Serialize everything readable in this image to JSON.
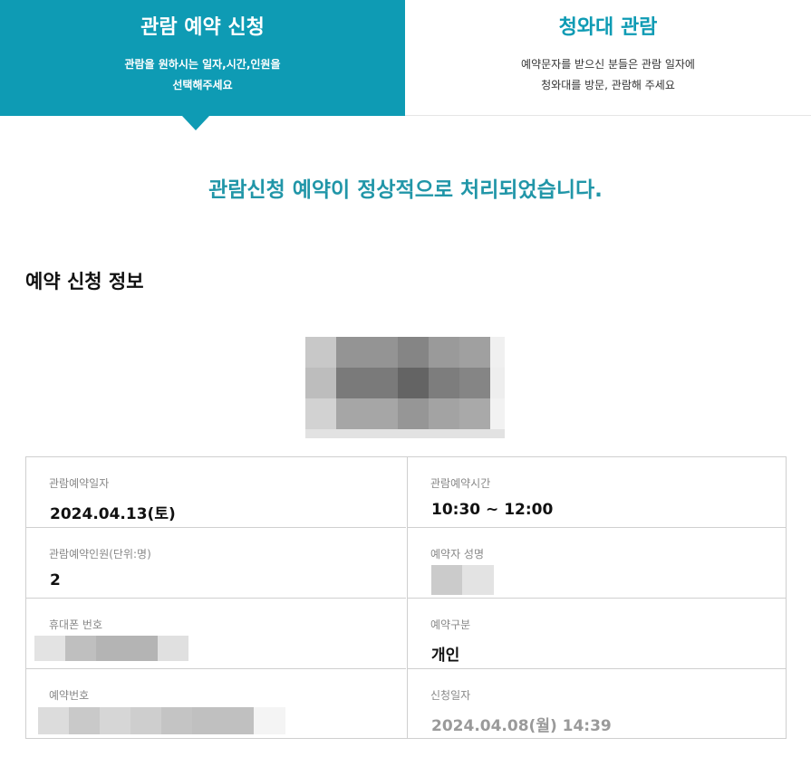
{
  "steps": [
    {
      "title": "관람 예약 신청",
      "desc_line1": "관람을 원하시는 일자,시간,인원을",
      "desc_line2": "선택해주세요"
    },
    {
      "title": "청와대 관람",
      "desc_line1": "예약문자를 받으신 분들은 관람 일자에",
      "desc_line2": "청와대를 방문, 관람해 주세요"
    }
  ],
  "confirmation": "관람신청 예약이 정상적으로 처리되었습니다.",
  "section_title": "예약 신청 정보",
  "info": {
    "visit_date": {
      "label": "관람예약일자",
      "value": "2024.04.13(토)"
    },
    "visit_time": {
      "label": "관람예약시간",
      "value": "10:30 ~ 12:00"
    },
    "visitors": {
      "label": "관람예약인원(단위:명)",
      "value": "2"
    },
    "applicant": {
      "label": "예약자 성명"
    },
    "phone": {
      "label": "휴대폰 번호"
    },
    "type": {
      "label": "예약구분",
      "value": "개인"
    },
    "reservation_no": {
      "label": "예약번호"
    },
    "applied_at": {
      "label": "신청일자",
      "value": "2024.04.08(월) 14:39"
    }
  }
}
